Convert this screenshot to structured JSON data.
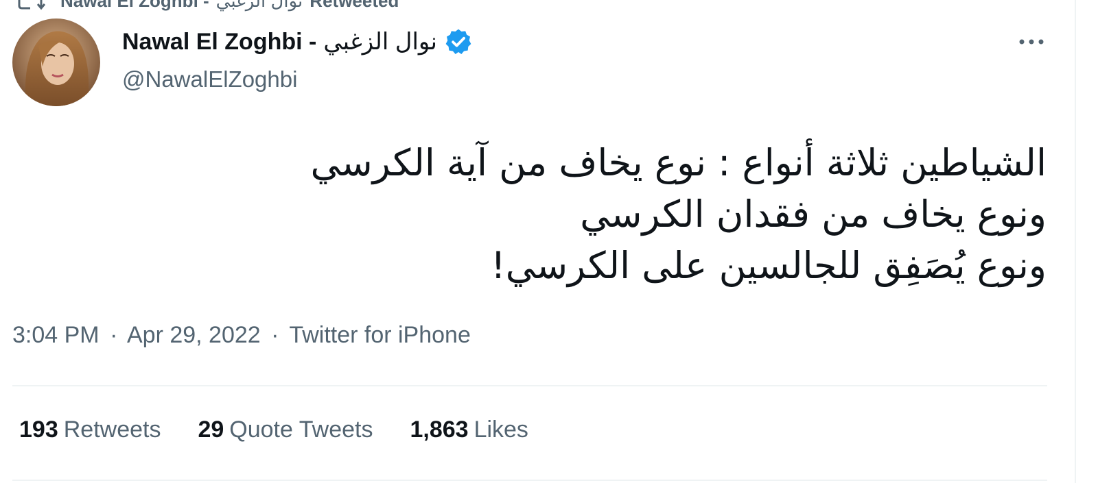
{
  "retweet_context": {
    "name_latin": "Nawal El Zoghbi -",
    "name_arabic": "نوال الزغبي",
    "label": "Retweeted"
  },
  "author": {
    "name_latin": "Nawal El Zoghbi -",
    "name_arabic": "نوال الزغبي",
    "handle": "@NawalElZoghbi",
    "verified": true
  },
  "tweet": {
    "lines": [
      "الشياطين ثلاثة أنواع : نوع يخاف من آية الكرسي",
      "ونوع يخاف من فقدان الكرسي",
      "ونوع يُصَفِق للجالسين على الكرسي!"
    ]
  },
  "meta": {
    "time": "3:04 PM",
    "date": "Apr 29, 2022",
    "source": "Twitter for iPhone",
    "separator": "·"
  },
  "stats": {
    "retweets": {
      "count": "193",
      "label": "Retweets"
    },
    "quotes": {
      "count": "29",
      "label": "Quote Tweets"
    },
    "likes": {
      "count": "1,863",
      "label": "Likes"
    }
  },
  "colors": {
    "text_primary": "#0f1419",
    "text_secondary": "#536471",
    "verified_blue": "#1d9bf0",
    "divider": "#eff3f4"
  },
  "icons": {
    "retweet": "retweet-icon",
    "verified": "verified-badge-icon",
    "more": "more-options-icon"
  }
}
